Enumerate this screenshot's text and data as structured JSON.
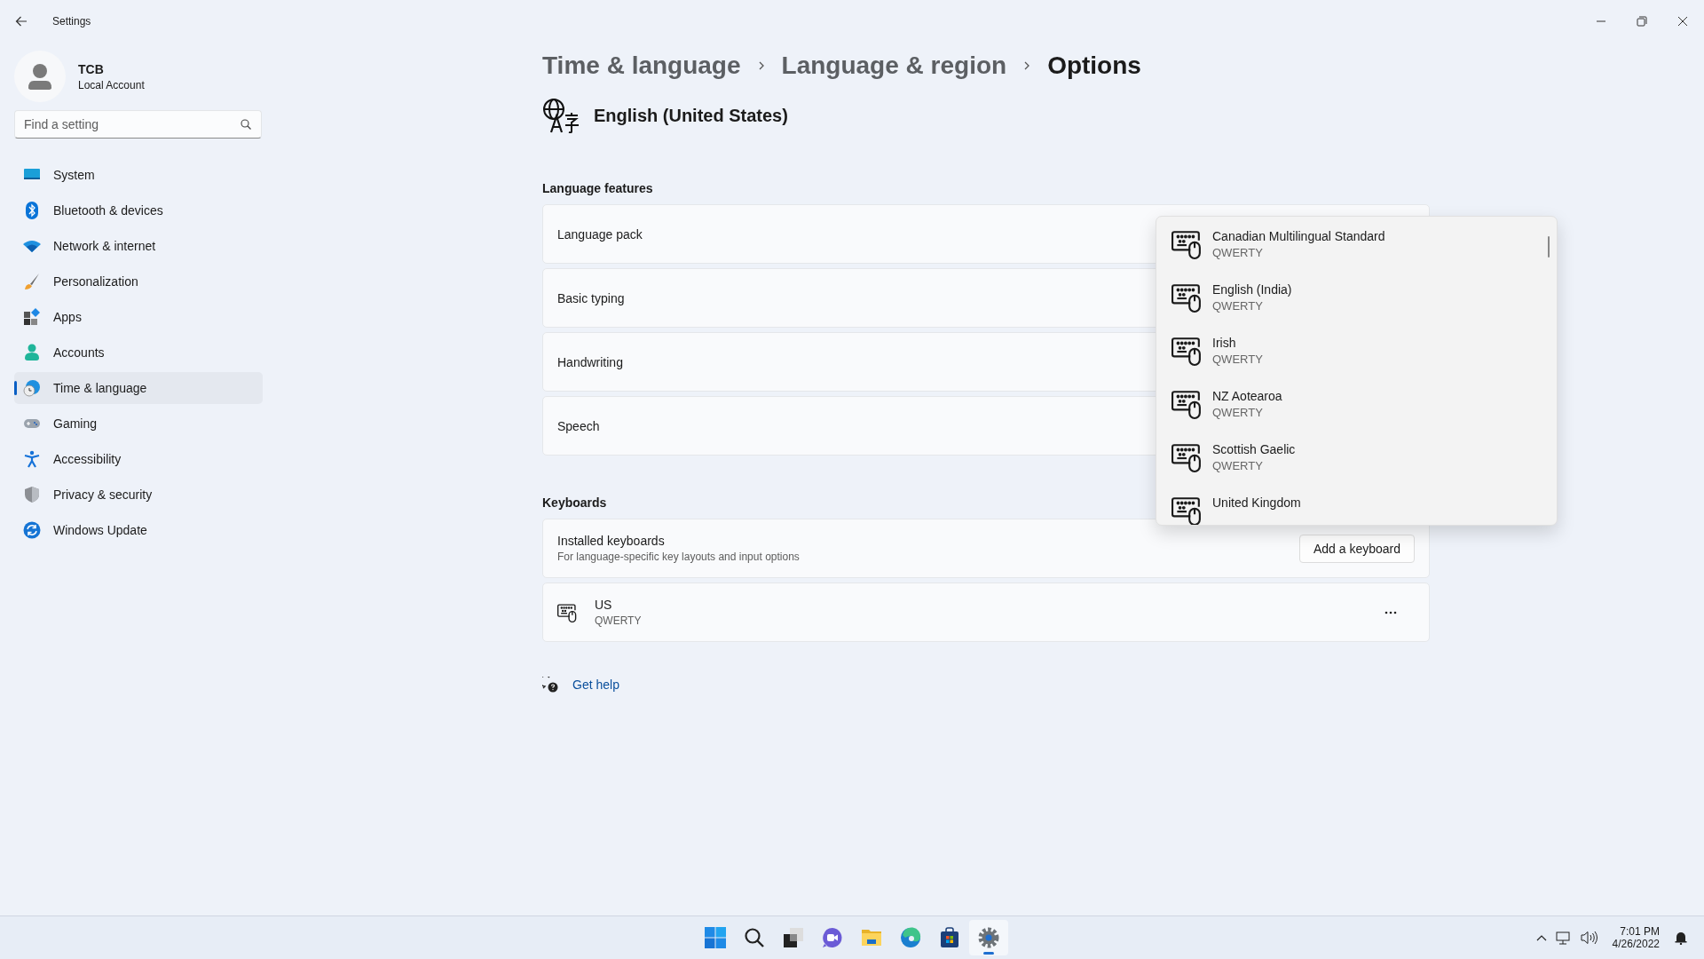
{
  "window": {
    "title": "Settings"
  },
  "account": {
    "name": "TCB",
    "type": "Local Account"
  },
  "search": {
    "placeholder": "Find a setting"
  },
  "nav": [
    {
      "label": "System",
      "selected": false
    },
    {
      "label": "Bluetooth & devices",
      "selected": false
    },
    {
      "label": "Network & internet",
      "selected": false
    },
    {
      "label": "Personalization",
      "selected": false
    },
    {
      "label": "Apps",
      "selected": false
    },
    {
      "label": "Accounts",
      "selected": false
    },
    {
      "label": "Time & language",
      "selected": true
    },
    {
      "label": "Gaming",
      "selected": false
    },
    {
      "label": "Accessibility",
      "selected": false
    },
    {
      "label": "Privacy & security",
      "selected": false
    },
    {
      "label": "Windows Update",
      "selected": false
    }
  ],
  "breadcrumb": [
    "Time & language",
    "Language & region",
    "Options"
  ],
  "language": "English (United States)",
  "sections": [
    {
      "heading": "Language features",
      "rows": [
        {
          "kind": "plain",
          "label": "Language pack"
        },
        {
          "kind": "plain",
          "label": "Basic typing"
        },
        {
          "kind": "plain",
          "label": "Handwriting"
        },
        {
          "kind": "plain",
          "label": "Speech"
        }
      ]
    },
    {
      "heading": "Keyboards",
      "rows": [
        {
          "kind": "action",
          "label": "Installed keyboards",
          "description": "For language-specific key layouts and input options",
          "button": "Add a keyboard"
        },
        {
          "kind": "keyboard",
          "label": "US",
          "layout": "QWERTY"
        }
      ]
    }
  ],
  "help_link": "Get help",
  "dropdown": {
    "items": [
      {
        "label": "Canadian Multilingual Standard",
        "layout": "QWERTY"
      },
      {
        "label": "English (India)",
        "layout": "QWERTY"
      },
      {
        "label": "Irish",
        "layout": "QWERTY"
      },
      {
        "label": "NZ Aotearoa",
        "layout": "QWERTY"
      },
      {
        "label": "Scottish Gaelic",
        "layout": "QWERTY"
      },
      {
        "label": "United Kingdom"
      }
    ]
  },
  "taskbar": {
    "apps": [
      {
        "kind": "start",
        "selected": false
      },
      {
        "kind": "search",
        "selected": false
      },
      {
        "kind": "taskview",
        "selected": false
      },
      {
        "kind": "chat",
        "selected": false
      },
      {
        "kind": "explorer",
        "selected": false
      },
      {
        "kind": "edge",
        "selected": false
      },
      {
        "kind": "store",
        "selected": false
      },
      {
        "kind": "settings",
        "selected": true
      }
    ],
    "time": "7:01 PM",
    "date": "4/26/2022"
  }
}
